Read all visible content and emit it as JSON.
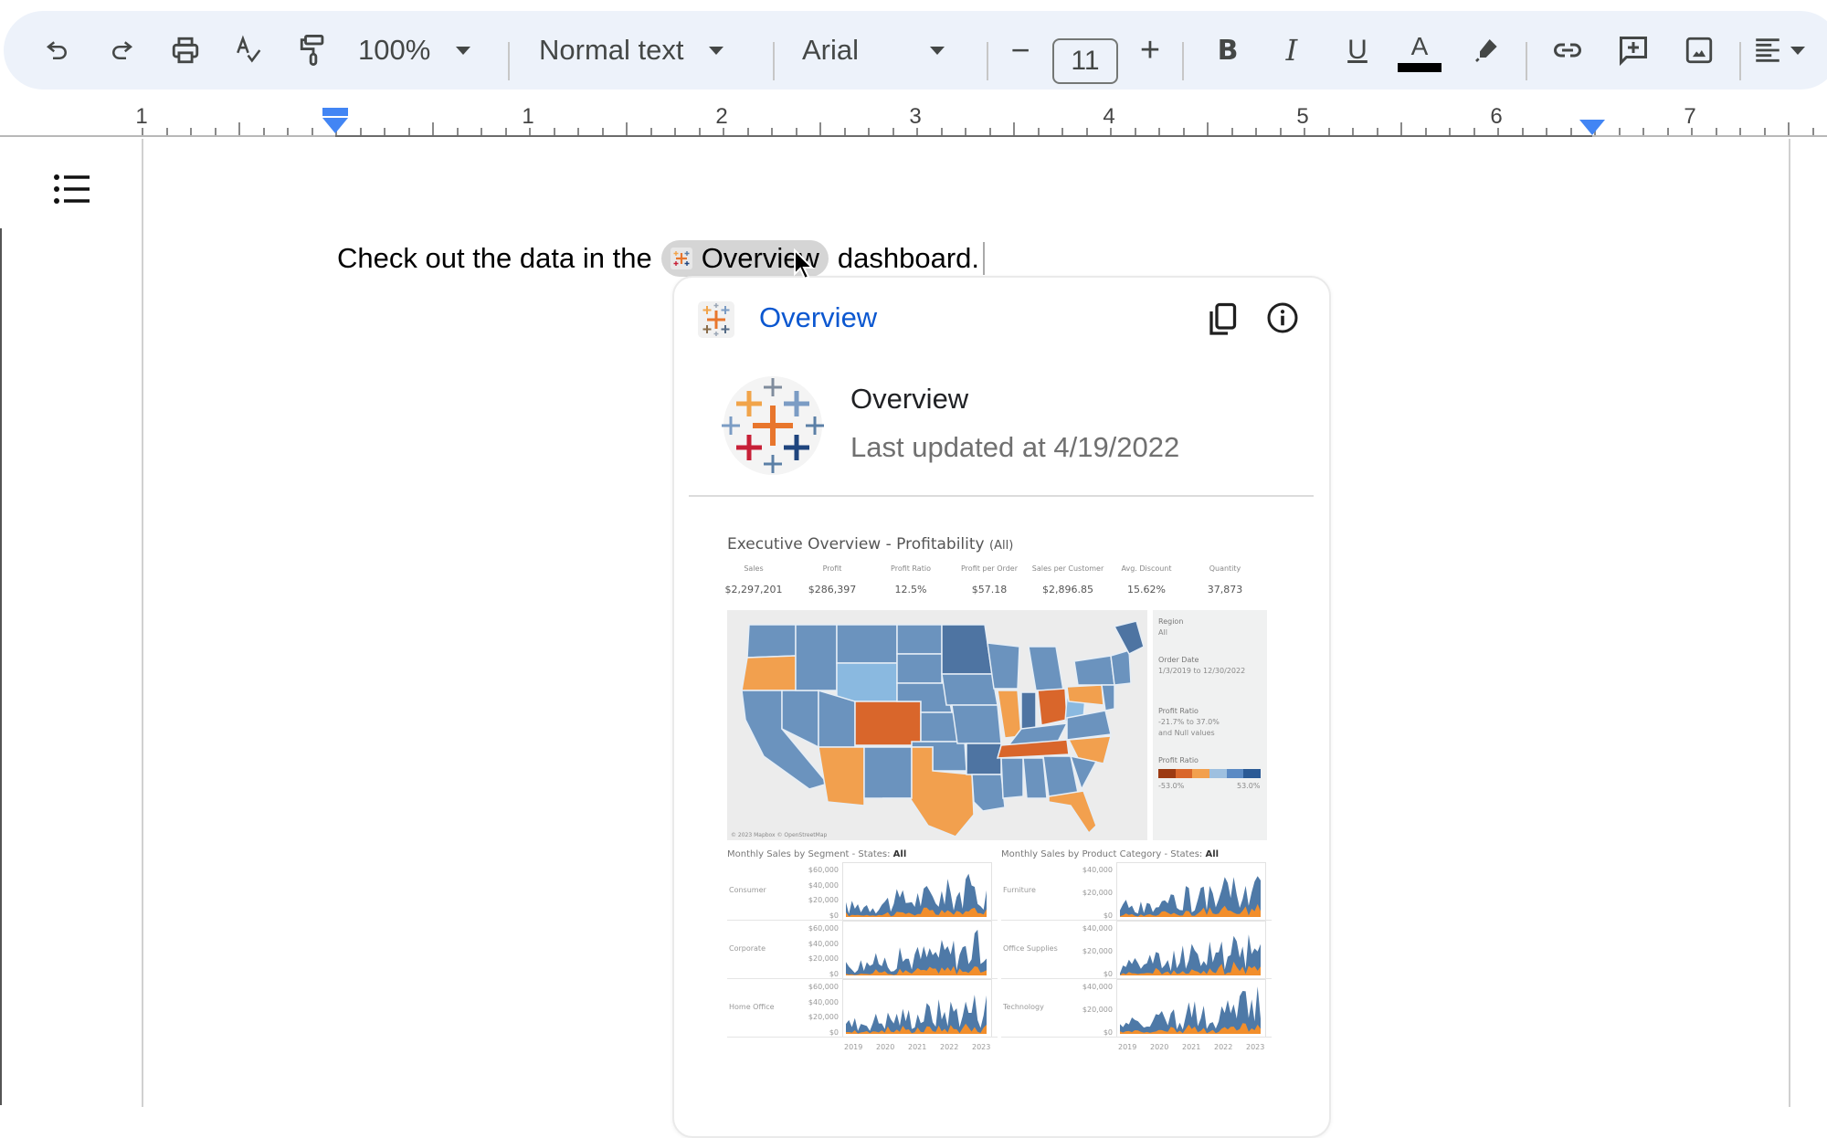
{
  "toolbar": {
    "undo": "undo-icon",
    "redo": "redo-icon",
    "print": "print-icon",
    "spellcheck": "spellcheck-icon",
    "paint_format": "paint-format-icon",
    "zoom": "100%",
    "style": "Normal text",
    "font": "Arial",
    "font_size": "11",
    "decrease_size": "−",
    "increase_size": "+",
    "bold": "B",
    "italic": "I",
    "underline": "U",
    "text_color_letter": "A",
    "text_color": "#000000"
  },
  "ruler": {
    "labels": [
      "1",
      "1",
      "2",
      "3",
      "4",
      "5",
      "6",
      "7"
    ],
    "indent_marker_color": "#4285f4"
  },
  "document": {
    "text_before": "Check out the data in the",
    "chip_label": "Overview",
    "text_after": "dashboard."
  },
  "card": {
    "title": "Overview",
    "name": "Overview",
    "updated": "Last updated at 4/19/2022",
    "link_color": "#0b57d0"
  },
  "dashboard": {
    "title": "Executive Overview - Profitability",
    "title_suffix": "(All)",
    "kpis": [
      {
        "label": "Sales",
        "value": "$2,297,201"
      },
      {
        "label": "Profit",
        "value": "$286,397"
      },
      {
        "label": "Profit Ratio",
        "value": "12.5%"
      },
      {
        "label": "Profit per Order",
        "value": "$57.18"
      },
      {
        "label": "Sales per Customer",
        "value": "$2,896.85"
      },
      {
        "label": "Avg. Discount",
        "value": "15.62%"
      },
      {
        "label": "Quantity",
        "value": "37,873"
      }
    ],
    "map_credit": "© 2023 Mapbox © OpenStreetMap",
    "filters": {
      "region_label": "Region",
      "region_value": "All",
      "order_date_label": "Order Date",
      "order_date_value": "1/3/2019 to 12/30/2022",
      "profit_ratio_label": "Profit Ratio",
      "profit_ratio_value": "-21.7% to 37.0%",
      "profit_ratio_null": "and Null values",
      "legend_label": "Profit Ratio",
      "legend_min": "-53.0%",
      "legend_max": "53.0%",
      "legend_colors": [
        "#9c3a12",
        "#d9662b",
        "#f2a04e",
        "#9ec0e0",
        "#5b8ac4",
        "#2b5a95"
      ]
    },
    "segment_chart": {
      "title": "Monthly Sales by Segment - States:",
      "title_bold": "All",
      "rows": [
        "Consumer",
        "Corporate",
        "Home Office"
      ],
      "y_ticks": [
        "$60,000",
        "$40,000",
        "$20,000",
        "$0"
      ],
      "years": [
        "2019",
        "2020",
        "2021",
        "2022",
        "2023"
      ]
    },
    "category_chart": {
      "title": "Monthly Sales by Product Category - States:",
      "title_bold": "All",
      "rows": [
        "Furniture",
        "Office Supplies",
        "Technology"
      ],
      "y_ticks": [
        "$40,000",
        "$20,000",
        "$0"
      ],
      "years": [
        "2019",
        "2020",
        "2021",
        "2022",
        "2023"
      ]
    },
    "colors": {
      "sales": "#4e79a7",
      "profit": "#f28e2b"
    }
  }
}
